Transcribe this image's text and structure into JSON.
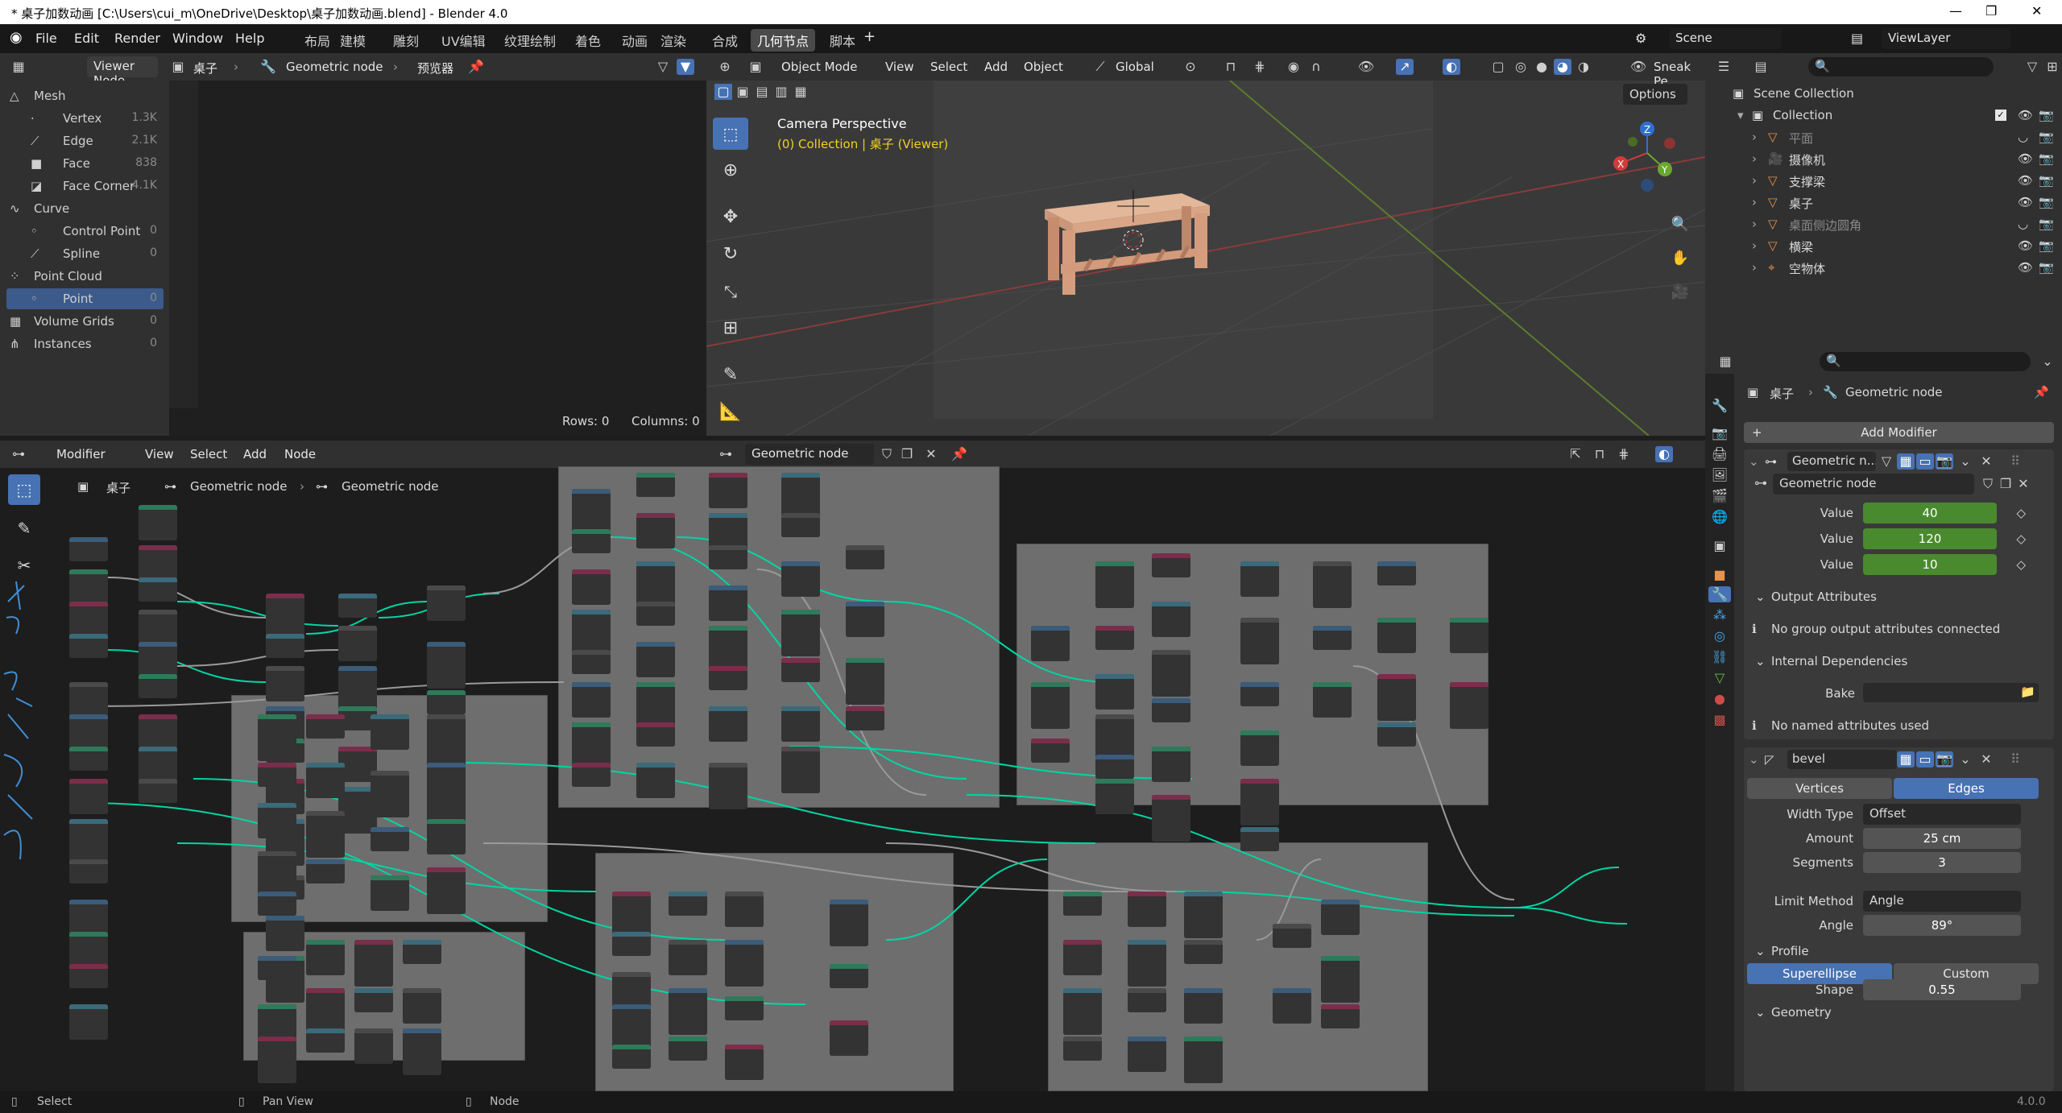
{
  "window": {
    "title": "* 桌子加数动画 [C:\\Users\\cui_m\\OneDrive\\Desktop\\桌子加数动画.blend] - Blender 4.0",
    "min": "—",
    "max": "❐",
    "close": "✕"
  },
  "menu": {
    "file": "File",
    "edit": "Edit",
    "render": "Render",
    "window": "Window",
    "help": "Help"
  },
  "workspaces": [
    "布局",
    "建模",
    "雕刻",
    "UV编辑",
    "纹理绘制",
    "着色",
    "动画",
    "渲染",
    "合成",
    "几何节点",
    "脚本"
  ],
  "active_workspace": "几何节点",
  "scene": "Scene",
  "view_layer": "ViewLayer",
  "spreadsheet": {
    "editor": "Viewer Node",
    "object": "桌子",
    "modifier": "Geometric node",
    "viewer": "预览器",
    "items": [
      {
        "label": "Mesh",
        "value": "",
        "indent": 0
      },
      {
        "label": "Vertex",
        "value": "1.3K",
        "indent": 1
      },
      {
        "label": "Edge",
        "value": "2.1K",
        "indent": 1
      },
      {
        "label": "Face",
        "value": "838",
        "indent": 1
      },
      {
        "label": "Face Corner",
        "value": "4.1K",
        "indent": 1
      },
      {
        "label": "Curve",
        "value": "",
        "indent": 0
      },
      {
        "label": "Control Point",
        "value": "0",
        "indent": 1
      },
      {
        "label": "Spline",
        "value": "0",
        "indent": 1
      },
      {
        "label": "Point Cloud",
        "value": "",
        "indent": 0
      },
      {
        "label": "Point",
        "value": "0",
        "indent": 1
      },
      {
        "label": "Volume Grids",
        "value": "0",
        "indent": 0
      },
      {
        "label": "Instances",
        "value": "0",
        "indent": 0
      }
    ],
    "rows": "Rows: 0",
    "columns": "Columns: 0"
  },
  "viewport": {
    "mode": "Object Mode",
    "menus": [
      "View",
      "Select",
      "Add",
      "Object"
    ],
    "transform": "Global",
    "options": "Options",
    "sneak": "Sneak Pe",
    "camera_label": "Camera Perspective",
    "collection_label": "(0) Collection | 桌子 (Viewer)"
  },
  "node_editor": {
    "editor": "Modifier",
    "menus": [
      "View",
      "Select",
      "Add",
      "Node"
    ],
    "tree_name": "Geometric node",
    "breadcrumb": [
      "桌子",
      "Geometric node",
      "Geometric node"
    ]
  },
  "outliner": {
    "root": "Scene Collection",
    "collection": "Collection",
    "items": [
      "平面",
      "摄像机",
      "支撑梁",
      "桌子",
      "桌面侧边圆角",
      "横梁",
      "空物体"
    ]
  },
  "properties": {
    "breadcrumb_object": "桌子",
    "breadcrumb_modifier": "Geometric node",
    "add_modifier": "Add Modifier",
    "mod1_name": "Geometric n...",
    "mod1_tree": "Geometric node",
    "values": [
      {
        "label": "Value",
        "value": "40"
      },
      {
        "label": "Value",
        "value": "120"
      },
      {
        "label": "Value",
        "value": "10"
      }
    ],
    "output_attributes": "Output Attributes",
    "no_output": "No group output attributes connected",
    "internal_deps": "Internal Dependencies",
    "bake": "Bake",
    "no_named": "No named attributes used",
    "mod2_name": "bevel",
    "tab_vertices": "Vertices",
    "tab_edges": "Edges",
    "width_type_label": "Width Type",
    "width_type": "Offset",
    "amount_label": "Amount",
    "amount": "25 cm",
    "segments_label": "Segments",
    "segments": "3",
    "limit_method_label": "Limit Method",
    "limit_method": "Angle",
    "angle_label": "Angle",
    "angle": "89°",
    "profile": "Profile",
    "superellipse": "Superellipse",
    "custom": "Custom",
    "shape_label": "Shape",
    "shape": "0.55",
    "geometry": "Geometry"
  },
  "status": {
    "select": "Select",
    "pan": "Pan View",
    "node": "Node",
    "version": "4.0.0"
  },
  "colors": {
    "accent": "#4772b3",
    "green_field": "#4a8a2e",
    "socket_geo": "#00d6a3"
  }
}
